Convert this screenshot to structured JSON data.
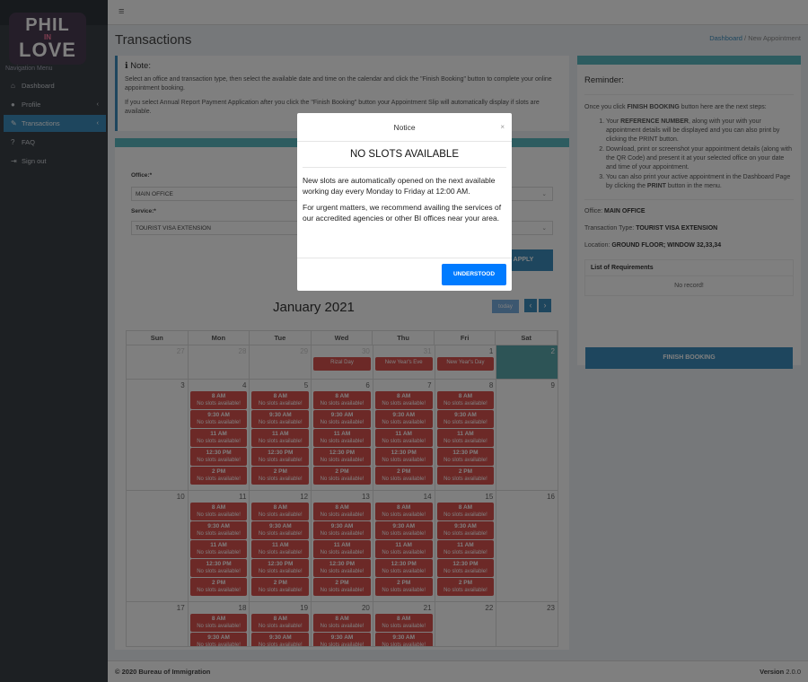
{
  "brand": {
    "line1": "PHIL",
    "line2": "IN",
    "line3": "LOVE"
  },
  "sidebar": {
    "header": "Navigation Menu",
    "items": [
      {
        "label": "Dashboard",
        "icon": "home-icon"
      },
      {
        "label": "Profile",
        "icon": "user-icon"
      },
      {
        "label": "Transactions",
        "icon": "edit-icon"
      },
      {
        "label": "FAQ",
        "icon": "question-icon"
      },
      {
        "label": "Sign out",
        "icon": "signout-icon"
      }
    ]
  },
  "page": {
    "title": "Transactions",
    "breadcrumb": {
      "home": "Dashboard",
      "sep": "/",
      "current": "New Appointment"
    }
  },
  "note": {
    "title": "Note:",
    "p1": "Select an office and transaction type, then select the available date and time on the calendar and click the \"Finish Booking\" button to complete your online appointment booking.",
    "p2": "If you select Annual Report Payment Application after you click the \"Finish Booking\" button your Appointment Slip will automatically display if slots are available."
  },
  "form": {
    "office_label": "Office:*",
    "office_value": "MAIN OFFICE",
    "service_label": "Service:*",
    "service_value": "TOURIST VISA EXTENSION",
    "apply": "APPLY"
  },
  "calendar": {
    "title": "January 2021",
    "today": "today",
    "weekdays": [
      "Sun",
      "Mon",
      "Tue",
      "Wed",
      "Thu",
      "Fri",
      "Sat"
    ],
    "weeks": [
      [
        {
          "d": "27",
          "o": true
        },
        {
          "d": "28",
          "o": true
        },
        {
          "d": "29",
          "o": true
        },
        {
          "d": "30",
          "o": true,
          "h": "Rizal Day"
        },
        {
          "d": "31",
          "o": true,
          "h": "New Year's Eve"
        },
        {
          "d": "1",
          "h": "New Year's Day"
        },
        {
          "d": "2",
          "t": true
        }
      ],
      [
        {
          "d": "3"
        },
        {
          "d": "4",
          "s": true
        },
        {
          "d": "5",
          "s": true
        },
        {
          "d": "6",
          "s": true
        },
        {
          "d": "7",
          "s": true
        },
        {
          "d": "8",
          "s": true
        },
        {
          "d": "9"
        }
      ],
      [
        {
          "d": "10"
        },
        {
          "d": "11",
          "s": true
        },
        {
          "d": "12",
          "s": true
        },
        {
          "d": "13",
          "s": true
        },
        {
          "d": "14",
          "s": true
        },
        {
          "d": "15",
          "s": true
        },
        {
          "d": "16"
        }
      ],
      [
        {
          "d": "17"
        },
        {
          "d": "18",
          "s": true
        },
        {
          "d": "19",
          "s": true
        },
        {
          "d": "20",
          "s": true
        },
        {
          "d": "21",
          "s": true
        },
        {
          "d": "22"
        },
        {
          "d": "23"
        }
      ]
    ],
    "slot_times": [
      "8 AM",
      "9:30 AM",
      "11 AM",
      "12:30 PM",
      "2 PM"
    ],
    "slot_status": "No slots available!"
  },
  "reminder": {
    "title": "Reminder:",
    "intro_pre": "Once you click ",
    "intro_bold": "FINISH BOOKING",
    "intro_post": " button here are the next steps:",
    "steps": [
      {
        "pre": "Your ",
        "bold": "REFERENCE NUMBER",
        "post": ", along with your with your appointment details will be displayed and you can also print by clicking the PRINT button."
      },
      {
        "pre": "Download, print or screenshot your appointment details (along with the QR Code) and present it at your selected office on your date and time of your appointment.",
        "bold": "",
        "post": ""
      },
      {
        "pre": "You can also print your active appointment in the Dashboard Page by clicking the ",
        "bold": "PRINT",
        "post": " button in the menu."
      }
    ],
    "office_label": "Office: ",
    "office_value": "MAIN OFFICE",
    "type_label": "Transaction Type: ",
    "type_value": "TOURIST VISA EXTENSION",
    "location_label": "Location: ",
    "location_value": "GROUND FLOOR; WINDOW 32,33,34",
    "req_title": "List of Requirements",
    "req_empty": "No record!",
    "finish": "FINISH BOOKING"
  },
  "footer": {
    "copyright": "© 2020 Bureau of Immigration",
    "version_label": "Version",
    "version": "2.0.0"
  },
  "modal": {
    "header": "Notice",
    "title": "NO SLOTS AVAILABLE",
    "p1": "New slots are automatically opened on the next available working day every Monday to Friday at 12:00 AM.",
    "p2": "For urgent matters, we recommend availing the services of our accredited agencies or other BI offices near your area.",
    "button": "UNDERSTOOD"
  },
  "colors": {
    "primary": "#3c8dbc",
    "slot": "#d9534f",
    "today": "#5ba8ad",
    "teal_bar": "#5bb8c1",
    "modal_button": "#007bff"
  }
}
